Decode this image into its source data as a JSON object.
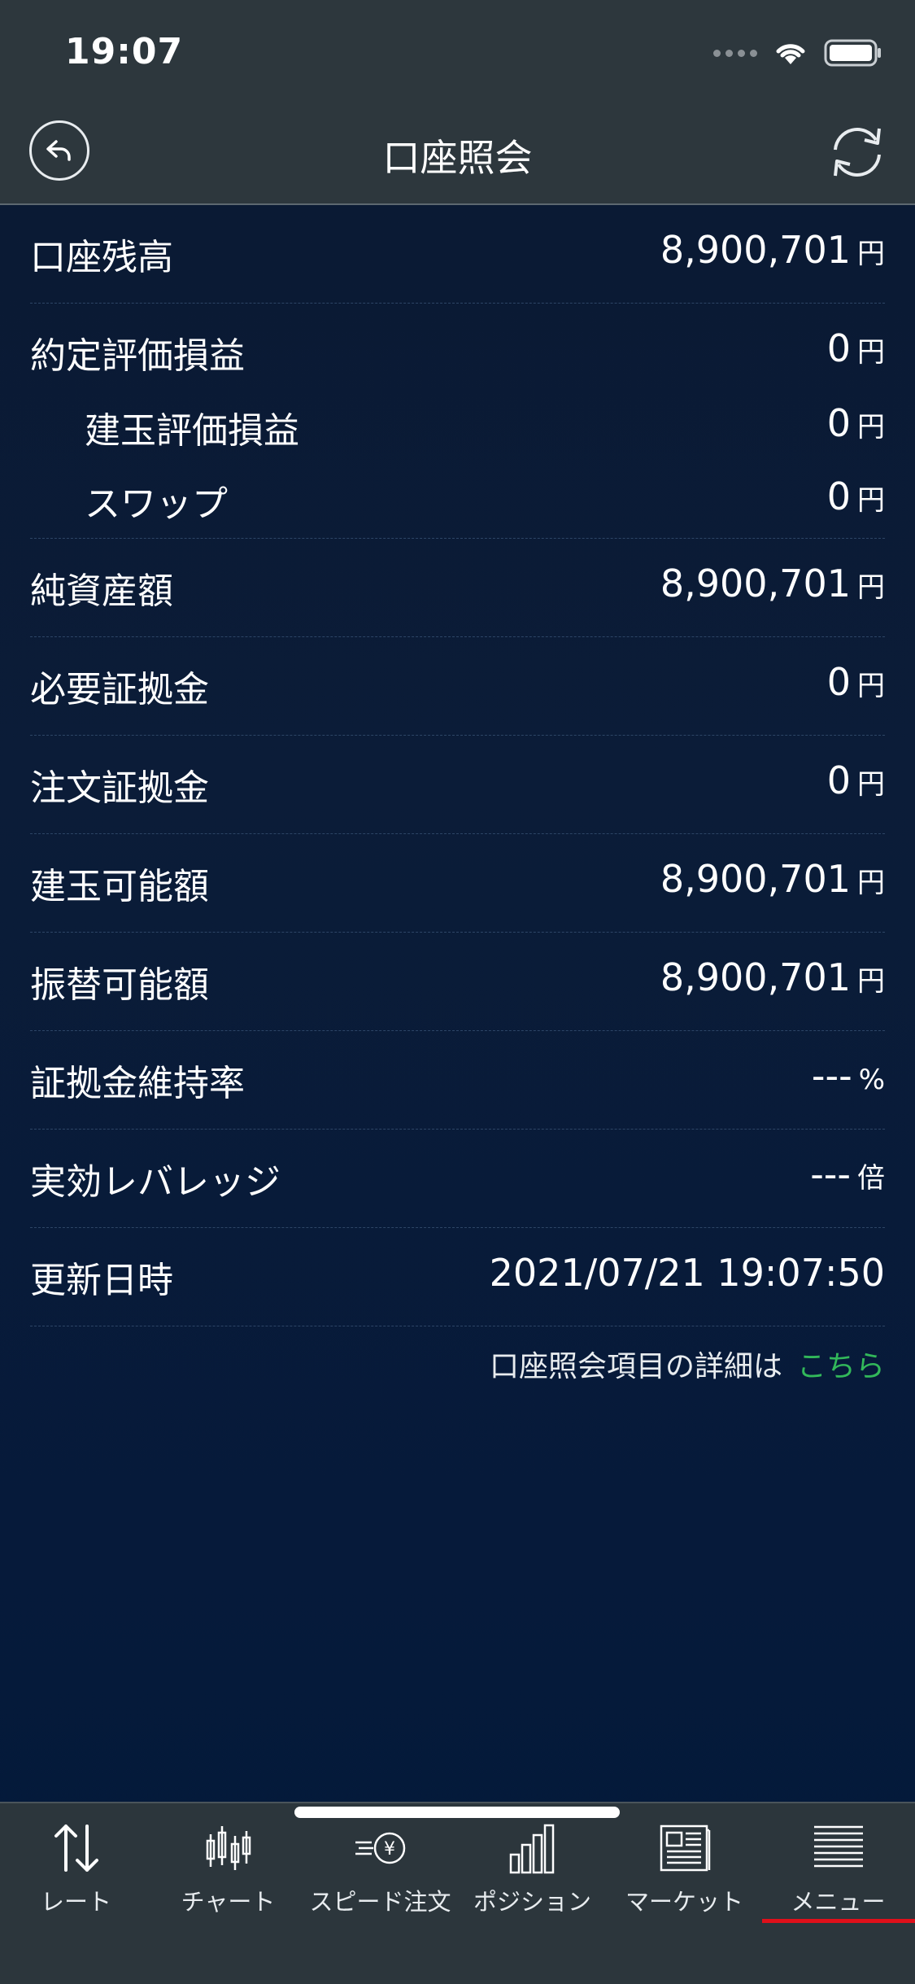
{
  "status": {
    "time": "19:07"
  },
  "header": {
    "title": "口座照会"
  },
  "rows": [
    {
      "label": "口座残高",
      "value": "8,900,701",
      "unit": "円"
    },
    {
      "label": "約定評価損益",
      "value": "0",
      "unit": "円",
      "subs": [
        {
          "label": "建玉評価損益",
          "value": "0",
          "unit": "円"
        },
        {
          "label": "スワップ",
          "value": "0",
          "unit": "円"
        }
      ]
    },
    {
      "label": "純資産額",
      "value": "8,900,701",
      "unit": "円"
    },
    {
      "label": "必要証拠金",
      "value": "0",
      "unit": "円"
    },
    {
      "label": "注文証拠金",
      "value": "0",
      "unit": "円"
    },
    {
      "label": "建玉可能額",
      "value": "8,900,701",
      "unit": "円"
    },
    {
      "label": "振替可能額",
      "value": "8,900,701",
      "unit": "円"
    },
    {
      "label": "証拠金維持率",
      "value": "---",
      "unit": "%"
    },
    {
      "label": "実効レバレッジ",
      "value": "---",
      "unit": "倍"
    },
    {
      "label": "更新日時",
      "value": "2021/07/21 19:07:50",
      "unit": ""
    }
  ],
  "note": {
    "text": "口座照会項目の詳細は",
    "link": "こちら"
  },
  "tabs": [
    {
      "label": "レート",
      "icon": "arrows-updown-icon"
    },
    {
      "label": "チャート",
      "icon": "candlestick-icon"
    },
    {
      "label": "スピード注文",
      "icon": "speed-yen-icon"
    },
    {
      "label": "ポジション",
      "icon": "bars-icon"
    },
    {
      "label": "マーケット",
      "icon": "newspaper-icon"
    },
    {
      "label": "メニュー",
      "icon": "menu-list-icon"
    }
  ],
  "active_tab": "メニュー",
  "colors": {
    "accent_link": "#32b85a",
    "active_tab_bar": "#e0101a",
    "header_bg": "#2d373d"
  }
}
